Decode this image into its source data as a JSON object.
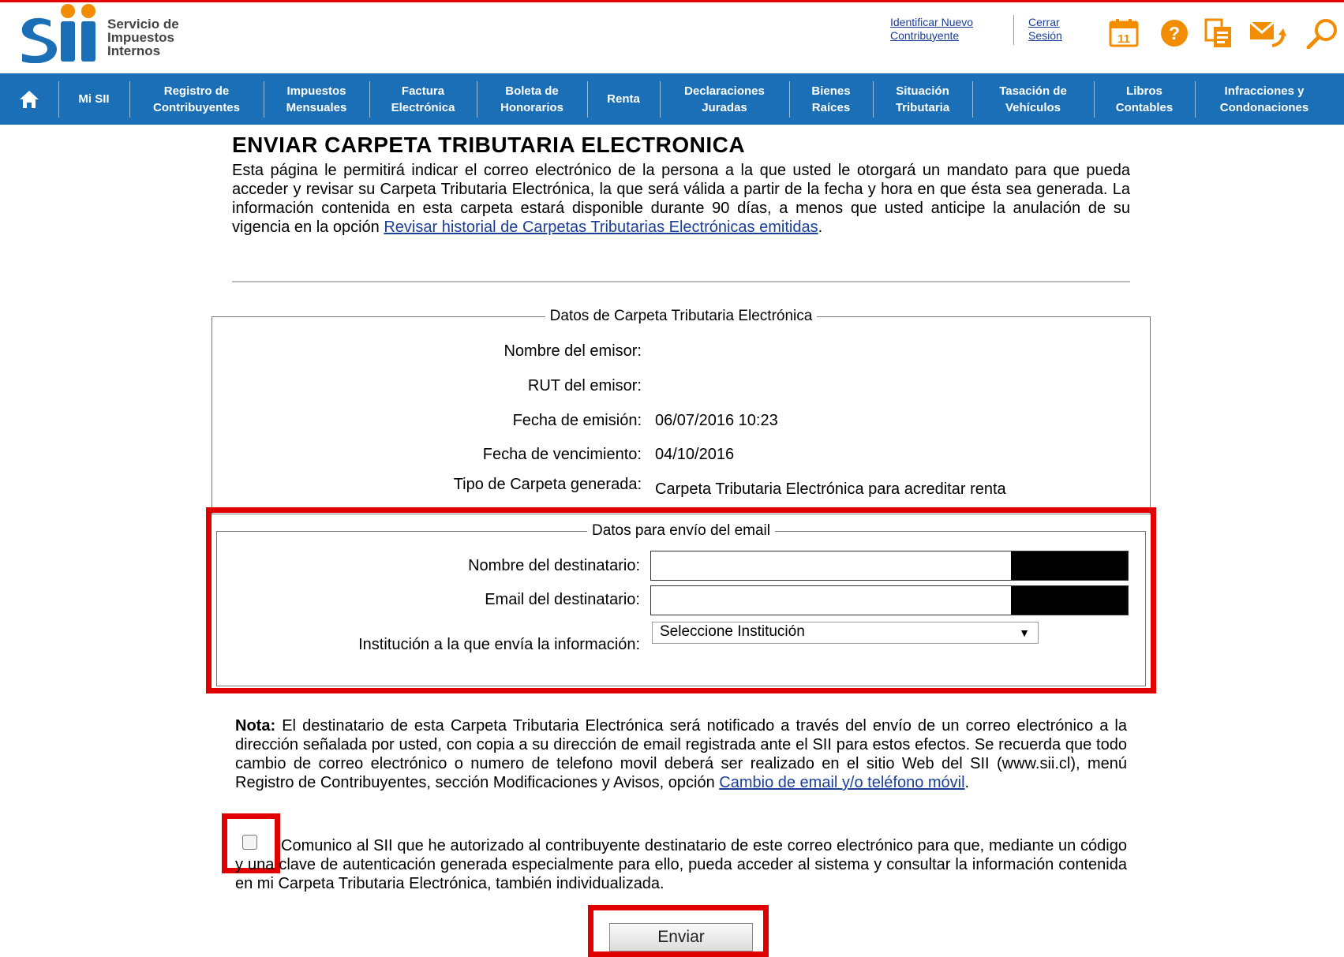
{
  "header": {
    "logo_mark": "Sii",
    "logo_lines": [
      "Servicio de",
      "Impuestos",
      "Internos"
    ],
    "link_identify": "Identificar Nuevo Contribuyente",
    "link_identify_line1": "Identificar Nuevo",
    "link_identify_line2": "Contribuyente",
    "link_logout_line1": "Cerrar",
    "link_logout_line2": "Sesión",
    "calendar_day": "11",
    "icons": [
      "calendar-icon",
      "help-icon",
      "documents-icon",
      "mail-icon",
      "search-icon"
    ],
    "colors": {
      "accent_red": "#e00000",
      "nav_blue": "#1a6fb7",
      "link_blue": "#1a3e9a",
      "orange": "#f28c00"
    }
  },
  "nav": {
    "home_icon": "home-icon",
    "items": [
      {
        "line1": "Mi SII",
        "line2": ""
      },
      {
        "line1": "Registro de",
        "line2": "Contribuyentes"
      },
      {
        "line1": "Impuestos",
        "line2": "Mensuales"
      },
      {
        "line1": "Factura",
        "line2": "Electrónica"
      },
      {
        "line1": "Boleta de",
        "line2": "Honorarios"
      },
      {
        "line1": "Renta",
        "line2": ""
      },
      {
        "line1": "Declaraciones",
        "line2": "Juradas"
      },
      {
        "line1": "Bienes",
        "line2": "Raíces"
      },
      {
        "line1": "Situación",
        "line2": "Tributaria"
      },
      {
        "line1": "Tasación de",
        "line2": "Vehículos"
      },
      {
        "line1": "Libros",
        "line2": "Contables"
      },
      {
        "line1": "Infracciones y",
        "line2": "Condonaciones"
      }
    ]
  },
  "main": {
    "title": "ENVIAR CARPETA TRIBUTARIA ELECTRONICA",
    "intro_text": "Esta página le permitirá indicar el correo electrónico de la persona a la que usted le otorgará un mandato para que pueda acceder y revisar su Carpeta Tributaria Electrónica, la que será válida a partir de la fecha y hora en que ésta sea generada. La información contenida en esta carpeta estará disponible durante 90 días, a menos que usted anticipe la anulación de su vigencia en la opción ",
    "intro_link": "Revisar historial de Carpetas Tributarias Electrónicas emitidas",
    "intro_end": "."
  },
  "carpeta": {
    "legend": "Datos de Carpeta Tributaria Electrónica",
    "emisor_label": "Nombre del emisor:",
    "emisor_value": "",
    "rut_label": "RUT del emisor:",
    "rut_value": "",
    "fecha_emision_label": "Fecha de emisión:",
    "fecha_emision_value": "06/07/2016 10:23",
    "fecha_vencimiento_label": "Fecha de vencimiento:",
    "fecha_vencimiento_value": "04/10/2016",
    "tipo_label": "Tipo de Carpeta generada:",
    "tipo_value": "Carpeta Tributaria Electrónica para acreditar renta"
  },
  "email": {
    "legend": "Datos para envío del email",
    "nombre_label": "Nombre del destinatario:",
    "nombre_value": "",
    "email_label": "Email del destinatario:",
    "email_value": "",
    "institucion_label": "Institución a la que envía la información:",
    "institucion_selected": "Seleccione Institución"
  },
  "note": {
    "bold": "Nota:",
    "text": " El destinatario de esta Carpeta Tributaria Electrónica será notificado a través del envío de un correo electrónico a la dirección señalada por usted, con copia a su dirección de email registrada ante el SII para estos efectos. Se recuerda que todo cambio de correo electrónico o numero de telefono movil deberá ser realizado en el sitio Web del SII (www.sii.cl), menú Registro de Contribuyentes, sección Modificaciones y Avisos, opción ",
    "link": "Cambio de email y/o teléfono móvil",
    "end": "."
  },
  "consent": {
    "checked": false,
    "text": "Comunico al SII que he autorizado al contribuyente destinatario de este correo electrónico para que, mediante un código y una clave de autenticación generada especialmente para ello, pueda acceder al sistema y consultar la información contenida en mi Carpeta Tributaria Electrónica, también individualizada."
  },
  "actions": {
    "submit_label": "Enviar"
  }
}
